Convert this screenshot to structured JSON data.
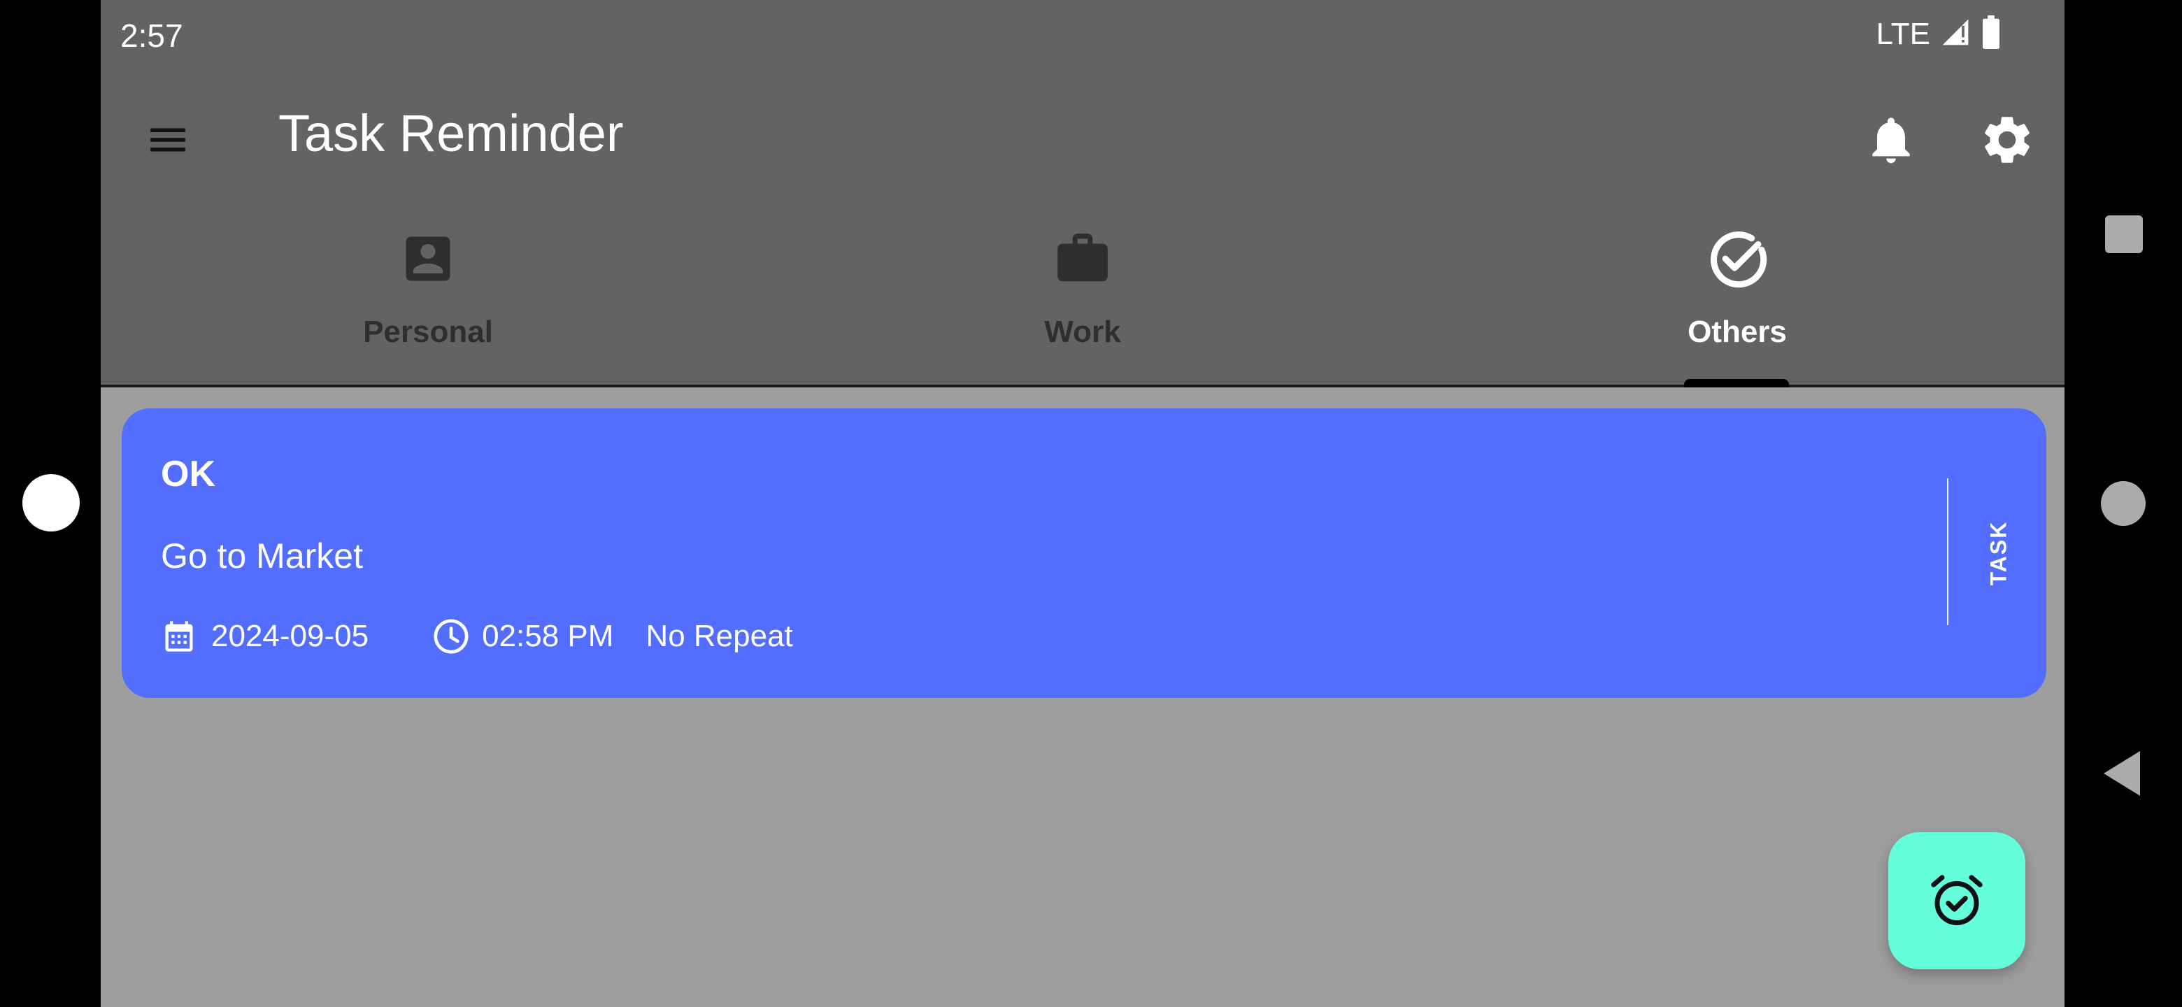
{
  "status_bar": {
    "time": "2:57",
    "network": "LTE",
    "icons": [
      "signal-icon",
      "battery-icon"
    ]
  },
  "app_bar": {
    "title": "Task Reminder",
    "icons": [
      "menu-icon",
      "bell-icon",
      "gear-icon"
    ]
  },
  "tabs": [
    {
      "label": "Personal",
      "icon": "person-icon",
      "active": false
    },
    {
      "label": "Work",
      "icon": "briefcase-icon",
      "active": false
    },
    {
      "label": "Others",
      "icon": "check-circle-icon",
      "active": true
    }
  ],
  "tasks": [
    {
      "title": "OK",
      "description": "Go to Market",
      "date": "2024-09-05",
      "time": "02:58 PM",
      "repeat": "No Repeat",
      "type": "TASK",
      "color": "#536dfe"
    }
  ],
  "fab": {
    "icon": "alarm-check-icon",
    "color": "#64ffda"
  },
  "colors": {
    "app_bar": "#636363",
    "background": "#9e9e9e",
    "inactive_tab": "#2e2e2e",
    "active_tab": "#ffffff"
  },
  "system_nav": [
    "recents-button",
    "home-button",
    "back-button"
  ]
}
